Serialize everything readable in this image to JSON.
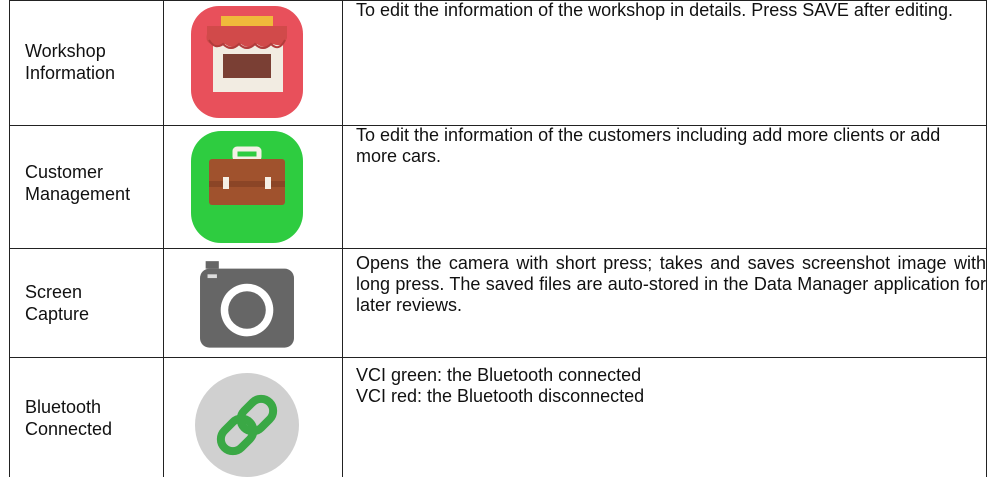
{
  "rows": [
    {
      "label_line1": "Workshop",
      "label_line2": "Information",
      "icon": "workshop-store-icon",
      "desc": "To edit the information of the workshop in details. Press SAVE after editing."
    },
    {
      "label_line1": "Customer",
      "label_line2": "Management",
      "icon": "customer-briefcase-icon",
      "desc": "To edit the information of the customers including add more clients or add more cars."
    },
    {
      "label_line1": "Screen",
      "label_line2": "Capture",
      "icon": "camera-icon",
      "desc": "Opens the camera with short press; takes and saves screenshot image with long press. The saved files are auto-stored in the Data Manager application for later reviews."
    },
    {
      "label_line1": "Bluetooth",
      "label_line2": "Connected",
      "icon": "bluetooth-link-icon",
      "desc_line1": "VCI green: the Bluetooth connected",
      "desc_line2": "VCI red: the Bluetooth disconnected"
    }
  ],
  "colors": {
    "workshop_bg": "#e8505b",
    "customer_bg": "#2ecc40",
    "camera_body": "#666666",
    "bluetooth_bg": "#d0d0d0",
    "link_green": "#3aa845"
  }
}
